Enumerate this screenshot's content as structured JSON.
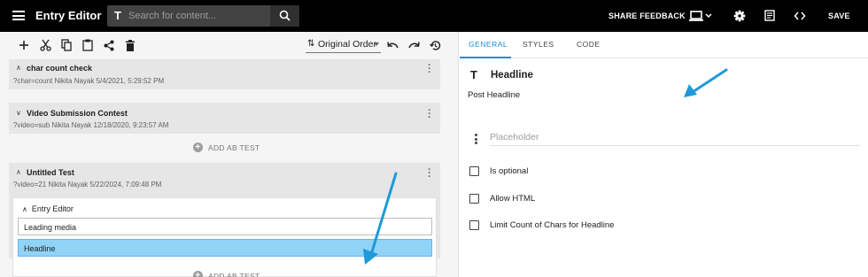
{
  "app": {
    "title": "Entry Editor"
  },
  "search": {
    "placeholder": "Search for content...",
    "type_glyph": "T"
  },
  "topbar": {
    "share_feedback": "SHARE FEEDBACK",
    "save": "SAVE"
  },
  "toolbar": {
    "order_label": "Original Order",
    "icons": [
      "add-icon",
      "cut-icon",
      "copy-icon",
      "paste-icon",
      "share-icon",
      "delete-icon",
      "undo-icon",
      "redo-icon",
      "history-icon"
    ]
  },
  "tests": [
    {
      "title": "char count check",
      "subtitle": "?char=count Nikita Nayak 5/4/2021, 5:29:52 PM"
    },
    {
      "title": "Video Submission Contest",
      "subtitle": "?video=sub Nikita Nayak 12/18/2020, 9:23:57 AM"
    },
    {
      "title": "Untitled Test",
      "subtitle": "?video=21 Nikita Nayak 5/22/2024, 7:09:48 PM"
    }
  ],
  "ab_test_label": "ADD AB TEST",
  "inner": {
    "title": "Entry Editor",
    "rows": [
      "Leading media",
      "Headline"
    ]
  },
  "tabs": [
    "GENERAL",
    "STYLES",
    "CODE"
  ],
  "field": {
    "type_glyph": "T",
    "title": "Headline",
    "subtitle": "Post Headline",
    "placeholder": "Placeholder"
  },
  "options": [
    "Is optional",
    "Allow HTML",
    "Limit Count of Chars for Headline"
  ],
  "colors": {
    "accent": "#1a8fd8",
    "selected_row": "#90d3f6",
    "annotation_arrow": "#1e9ad8"
  }
}
